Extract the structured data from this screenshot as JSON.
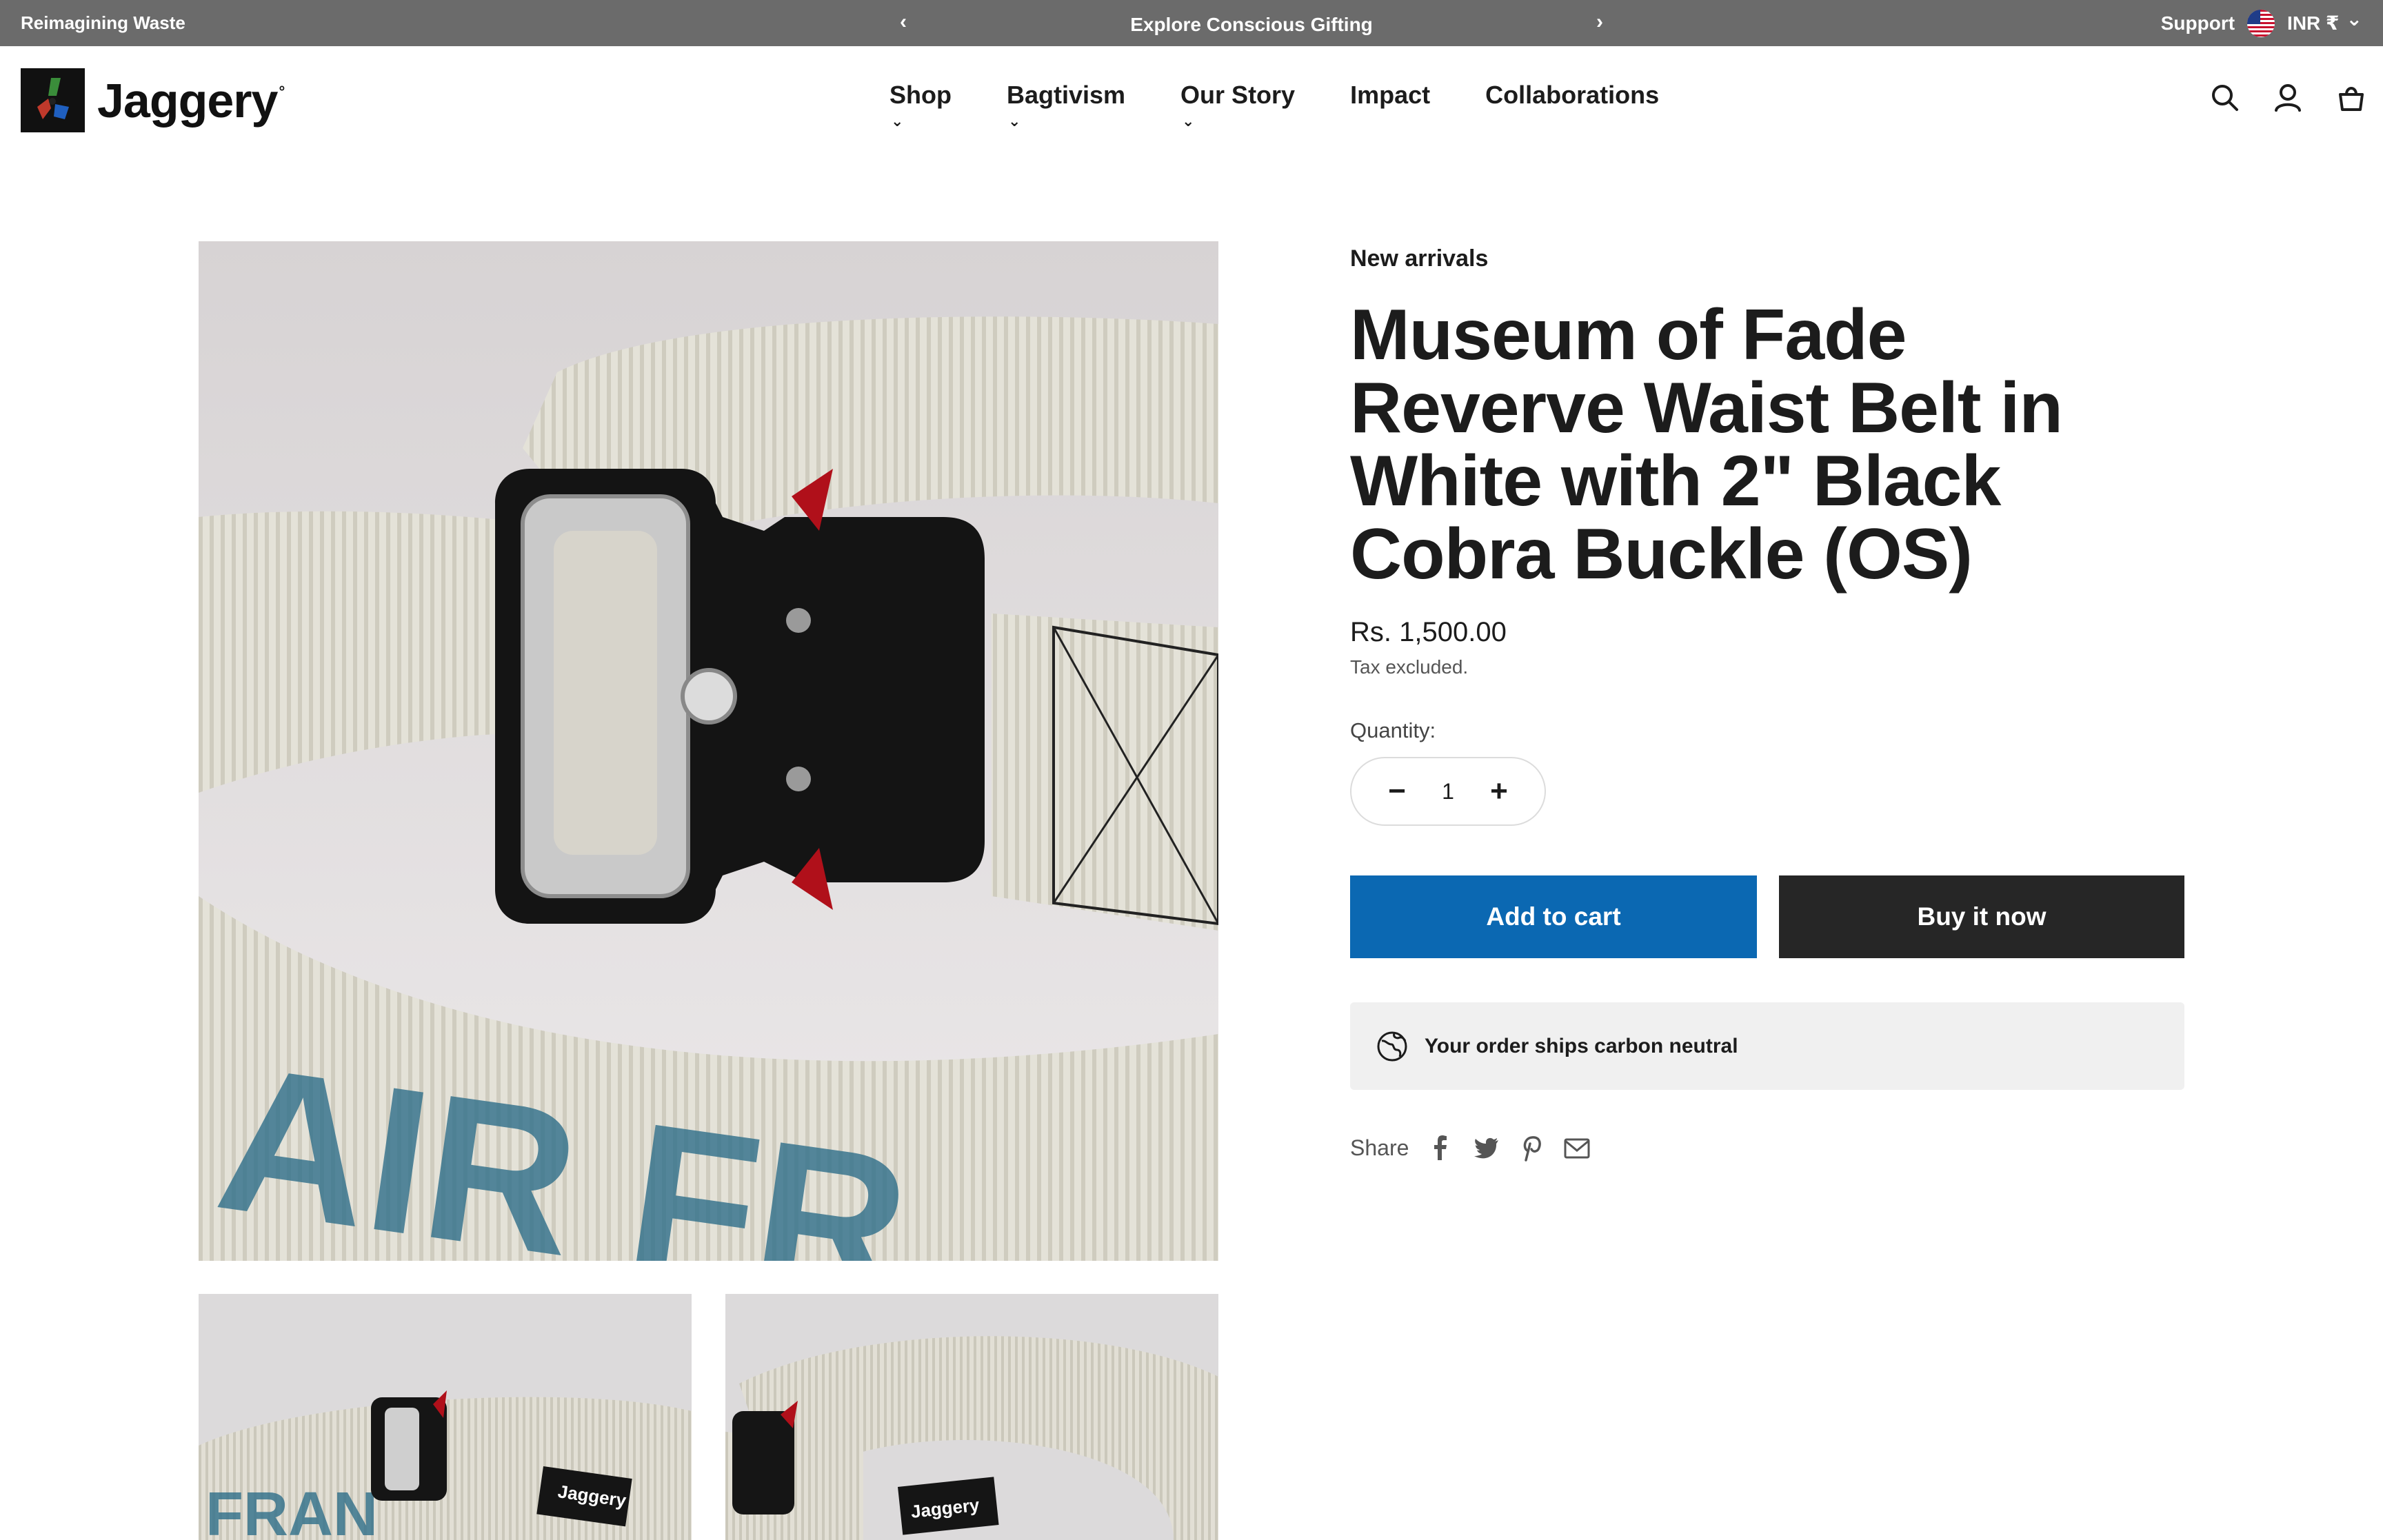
{
  "announcement": {
    "left_text": "Reimagining Waste",
    "center_text": "Explore Conscious Gifting",
    "prev_icon": "‹",
    "next_icon": "›",
    "support_label": "Support",
    "currency_label": "INR ₹",
    "currency_caret": "⌄"
  },
  "header": {
    "logo_text": "Jaggery",
    "logo_mark": "°",
    "nav": [
      {
        "label": "Shop",
        "caret": "⌄"
      },
      {
        "label": "Bagtivism",
        "caret": "⌄"
      },
      {
        "label": "Our Story",
        "caret": "⌄"
      },
      {
        "label": "Impact",
        "caret": ""
      },
      {
        "label": "Collaborations",
        "caret": ""
      }
    ],
    "icons": [
      "search-icon",
      "account-icon",
      "cart-icon"
    ]
  },
  "gallery": {
    "thumb_label": "Jaggery"
  },
  "product": {
    "eyebrow": "New arrivals",
    "title": "Museum of Fade Reverve Waist Belt in White with 2\" Black Cobra Buckle (OS)",
    "price": "Rs. 1,500.00",
    "tax_note": "Tax excluded.",
    "quantity_label": "Quantity:",
    "quantity_value": "1",
    "minus": "−",
    "plus": "+",
    "add_to_cart": "Add to cart",
    "buy_now": "Buy it now",
    "carbon_text": "Your order ships carbon neutral",
    "share_label": "Share"
  },
  "colors": {
    "announcement_bg": "#6b6b6b",
    "add_to_cart_bg": "#0b68b2",
    "buy_now_bg": "#262626",
    "carbon_bg": "#f0f0f0"
  }
}
